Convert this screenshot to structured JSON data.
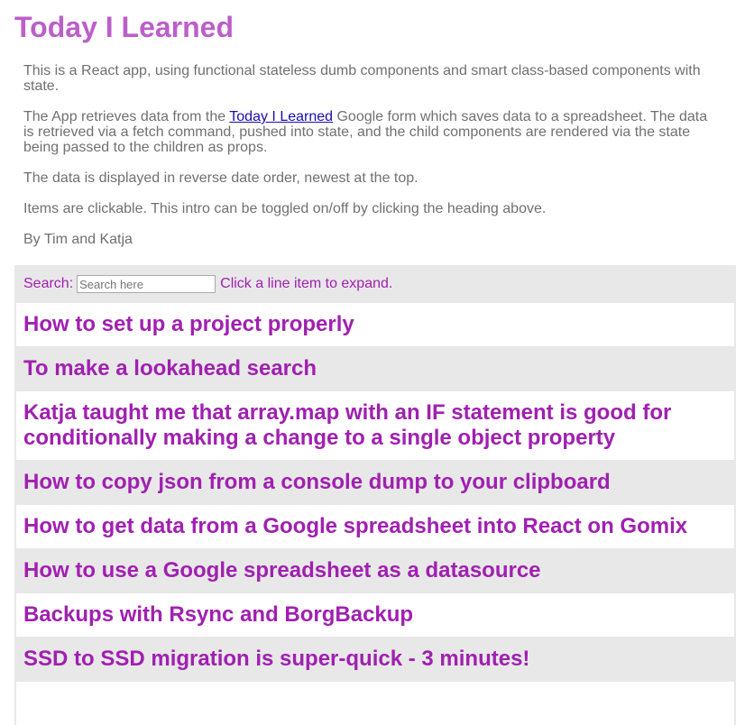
{
  "title": "Today I Learned",
  "intro": {
    "p1": "This is a React app, using functional stateless dumb components and smart class-based components with state.",
    "p2_before": "The App retrieves data from the ",
    "p2_link": "Today I Learned",
    "p2_after": " Google form which saves data to a spreadsheet. The data is retrieved via a fetch command, pushed into state, and the child components are rendered via the state being passed to the children as props.",
    "p3": "The data is displayed in reverse date order, newest at the top.",
    "p4": "Items are clickable. This intro can be toggled on/off by clicking the heading above.",
    "p5": "By Tim and Katja"
  },
  "search": {
    "label": "Search:",
    "placeholder": "Search here",
    "hint": "Click a line item to expand."
  },
  "items": [
    "How to set up a project properly",
    "To make a lookahead search",
    "Katja taught me that array.map with an IF statement is good for conditionally making a change to a single object property",
    "How to copy json from a console dump to your clipboard",
    "How to get data from a Google spreadsheet into React on Gomix",
    "How to use a Google spreadsheet as a datasource",
    "Backups with Rsync and BorgBackup",
    "SSD to SSD migration is super-quick - 3 minutes!"
  ]
}
